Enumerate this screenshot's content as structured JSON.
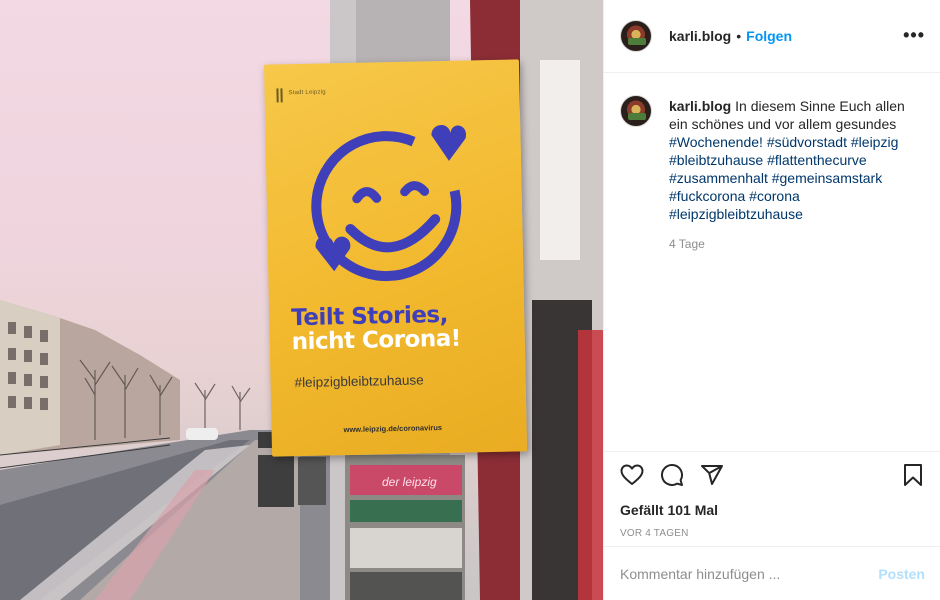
{
  "colors": {
    "link": "#0095f6",
    "hashtag": "#00376b",
    "muted": "#8e8e8e",
    "poster_yellow": "#f2b92e",
    "poster_blue": "#3f3fb9"
  },
  "photo": {
    "poster": {
      "city_label": "Stadt Leipzig",
      "headline_line1": "Teilt Stories,",
      "headline_line2": "nicht Corona!",
      "hashtag": "#leipzigbleibtzuhause",
      "url": "www.leipzig.de/coronavirus",
      "sticker_text": "der leipzig"
    }
  },
  "header": {
    "username": "karli.blog",
    "separator": "•",
    "follow_label": "Folgen",
    "more_icon": "ellipsis-icon"
  },
  "caption": {
    "username": "karli.blog",
    "text": "In diesem Sinne Euch allen ein schönes und vor allem gesundes",
    "hashtags": [
      "#Wochenende!",
      "#südvorstadt",
      "#leipzig",
      "#bleibtzuhause",
      "#flattenthecurve",
      "#zusammenhalt",
      "#gemeinsamstark",
      "#fuckcorona",
      "#corona",
      "#leipzigbleibtzuhause"
    ],
    "time": "4 Tage"
  },
  "actions": {
    "icons": [
      "heart-icon",
      "comment-icon",
      "share-icon",
      "bookmark-icon"
    ],
    "likes": "Gefällt 101 Mal",
    "date": "VOR 4 TAGEN"
  },
  "comment_box": {
    "placeholder": "Kommentar hinzufügen ...",
    "post_label": "Posten"
  }
}
